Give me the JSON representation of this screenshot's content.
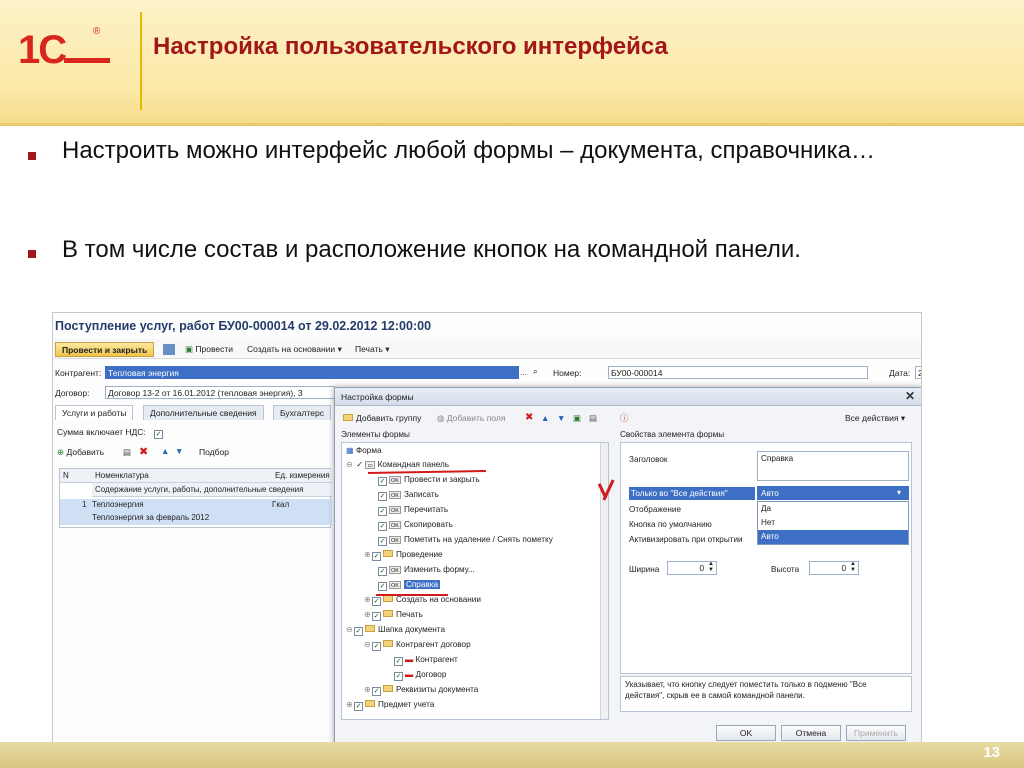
{
  "slide": {
    "logo": "1С",
    "logo_mark": "®",
    "title": "Настройка пользовательского интерфейса",
    "bullets": [
      "Настроить можно интерфейс любой формы – документа, справочника…",
      "В том числе состав и расположение кнопок на командной панели."
    ],
    "page_number": "13",
    "colors": {
      "accent": "#a3161a",
      "brand": "#d9261c",
      "header_bg": "#fbe9a8"
    }
  },
  "doc": {
    "title": "Поступление услуг, работ БУ00-000014 от 29.02.2012 12:00:00",
    "toolbar": {
      "post_close": "Провести и закрыть",
      "post": "Провести",
      "create_based": "Создать на основании",
      "print": "Печать"
    },
    "fields": {
      "counterparty_label": "Контрагент:",
      "counterparty_value": "Тепловая энергия",
      "number_label": "Номер:",
      "number_value": "БУ00-000014",
      "date_label": "Дата:",
      "date_value": "2",
      "contract_label": "Договор:",
      "contract_value": "Договор 13-2 от 16.01.2012 (тепловая энергия), 3"
    },
    "tabs": [
      "Услуги и работы",
      "Дополнительные сведения",
      "Бухгалтерс"
    ],
    "vat_label": "Сумма включает НДС:",
    "grid_toolbar": {
      "add": "Добавить",
      "pick": "Подбор"
    },
    "grid": {
      "columns": [
        "N",
        "Номенклатура",
        "Ед. измерения"
      ],
      "subheader": "Содержание услуги, работы, дополнительные сведения",
      "rows": [
        {
          "n": "1",
          "item": "Теплоэнергия",
          "unit": "Гкал"
        },
        {
          "n": "",
          "item": "Теплоэнергия за февраль 2012",
          "unit": ""
        }
      ]
    }
  },
  "dialog": {
    "title": "Настройка формы",
    "toolbar": {
      "add_group": "Добавить группу",
      "add_field": "Добавить поля",
      "all_actions": "Все действия"
    },
    "elements_label": "Элементы формы",
    "props_label": "Свойства элемента формы",
    "tree": [
      {
        "label": "Форма"
      },
      {
        "label": "Командная панель"
      },
      {
        "label": "Провести и закрыть"
      },
      {
        "label": "Записать"
      },
      {
        "label": "Перечитать"
      },
      {
        "label": "Скопировать"
      },
      {
        "label": "Пометить на удаление / Снять пометку"
      },
      {
        "label": "Проведение"
      },
      {
        "label": "Изменить форму..."
      },
      {
        "label": "Справка"
      },
      {
        "label": "Создать на основании"
      },
      {
        "label": "Печать"
      },
      {
        "label": "Шапка документа"
      },
      {
        "label": "Контрагент договор"
      },
      {
        "label": "Контрагент"
      },
      {
        "label": "Договор"
      },
      {
        "label": "Реквизиты документа"
      },
      {
        "label": "Предмет учета"
      }
    ],
    "props": {
      "header_label": "Заголовок",
      "header_value": "Справка",
      "only_all_label": "Только во \"Все действия\"",
      "only_all_value": "Авто",
      "display_label": "Отображение",
      "default_btn_label": "Кнопка по умолчанию",
      "activate_label": "Активизировать при открытии",
      "dropdown_options": [
        "Да",
        "Нет",
        "Авто"
      ],
      "width_label": "Ширина",
      "width_value": "0",
      "height_label": "Высота",
      "height_value": "0"
    },
    "note": "Указывает, что кнопку следует поместить только в подменю \"Все действия\", скрыв ее в самой командной панели.",
    "buttons": {
      "ok": "OK",
      "cancel": "Отмена",
      "apply": "Применить"
    }
  }
}
